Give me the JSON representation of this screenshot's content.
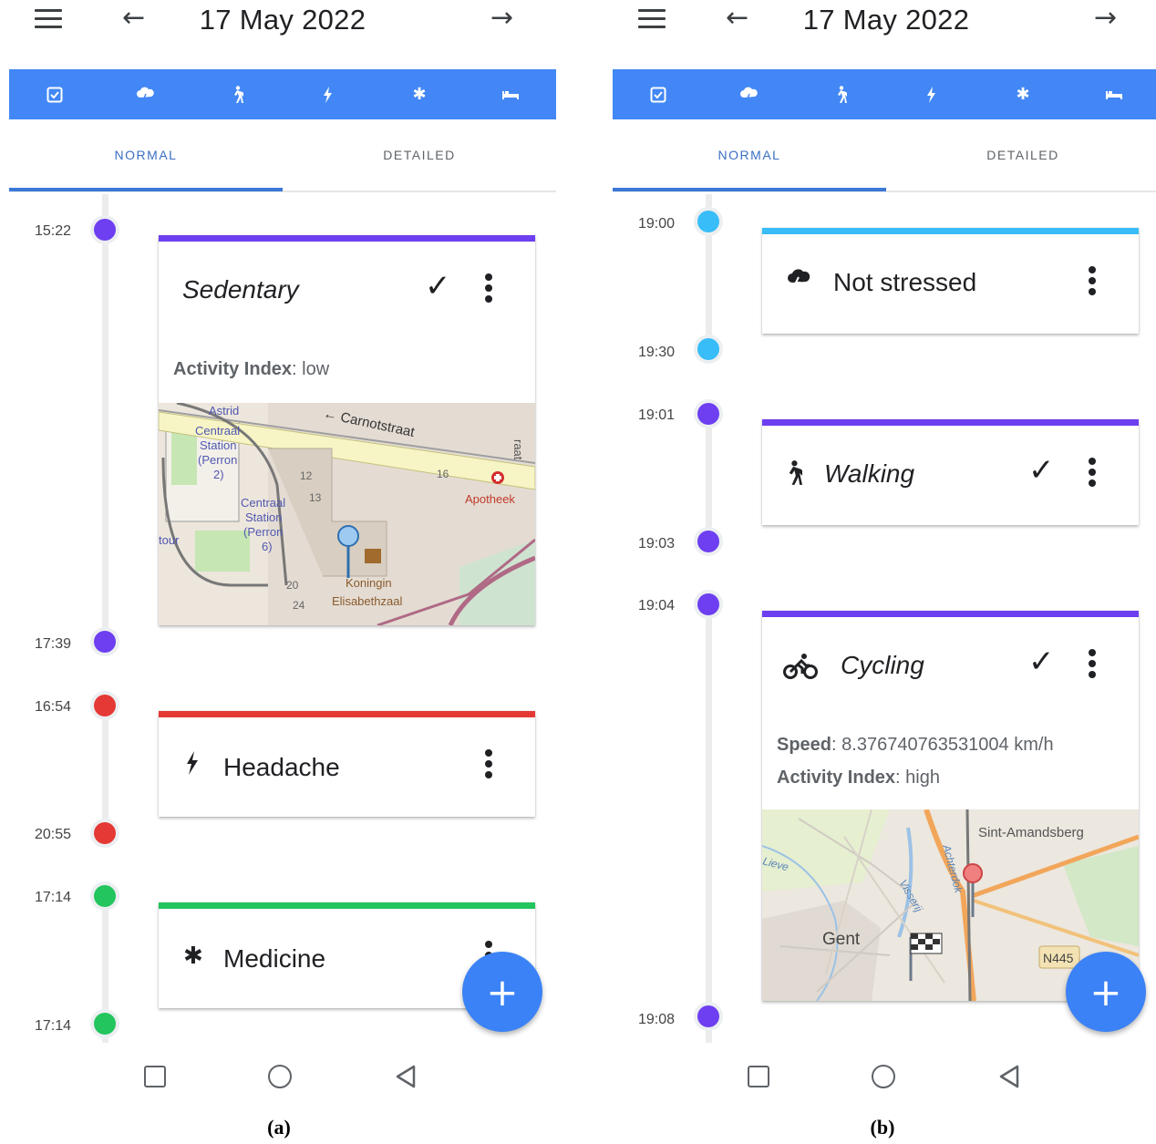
{
  "colors": {
    "accent": "#4287f5",
    "tab_active": "#3a6fc4",
    "purple": "#6d3ff0",
    "red": "#e53935",
    "green": "#22c55e",
    "cyan": "#38bdf8"
  },
  "icons": {
    "category": [
      "checkbox-icon",
      "stress-icon",
      "walking-icon",
      "bolt-icon",
      "asterisk-icon",
      "bed-icon"
    ]
  },
  "panel_a": {
    "caption": "(a)",
    "header": {
      "date": "17 May 2022"
    },
    "tabs": [
      "NORMAL",
      "DETAILED"
    ],
    "timeline": [
      {
        "time": "15:22",
        "color": "#6d3ff0"
      },
      {
        "time": "17:39",
        "color": "#6d3ff0"
      },
      {
        "time": "16:54",
        "color": "#e53935"
      },
      {
        "time": "20:55",
        "color": "#e53935"
      },
      {
        "time": "17:14",
        "color": "#22c55e"
      },
      {
        "time": "17:14",
        "color": "#22c55e"
      }
    ],
    "cards": {
      "sedentary": {
        "title": "Sedentary",
        "props": [
          {
            "key": "Activity Index",
            "value": ": low"
          }
        ],
        "map_labels": [
          "Carnotstraat",
          "Centraal Station (Perron 2)",
          "Centraal Station (Perron 6)",
          "Apotheek",
          "Koningin Elisabethzaal",
          "Astrid",
          "12",
          "13",
          "16",
          "20",
          "24",
          "raat",
          "tour"
        ]
      },
      "headache": {
        "title": "Headache"
      },
      "medicine": {
        "title": "Medicine"
      }
    }
  },
  "panel_b": {
    "caption": "(b)",
    "header": {
      "date": "17 May 2022"
    },
    "tabs": [
      "NORMAL",
      "DETAILED"
    ],
    "timeline": [
      {
        "time": "19:00",
        "color": "#38bdf8"
      },
      {
        "time": "19:30",
        "color": "#38bdf8"
      },
      {
        "time": "19:01",
        "color": "#6d3ff0"
      },
      {
        "time": "19:03",
        "color": "#6d3ff0"
      },
      {
        "time": "19:04",
        "color": "#6d3ff0"
      },
      {
        "time": "19:08",
        "color": "#6d3ff0"
      }
    ],
    "cards": {
      "stress": {
        "title": "Not stressed"
      },
      "walking": {
        "title": "Walking"
      },
      "cycling": {
        "title": "Cycling",
        "props": [
          {
            "key": "Speed",
            "value": ": 8.376740763531004 km/h"
          },
          {
            "key": "Activity Index",
            "value": ": high"
          }
        ],
        "map_labels": [
          "Sint-Amandsberg",
          "Gent",
          "N445",
          "Lieve",
          "Achterdok",
          "Visserij"
        ]
      }
    }
  }
}
